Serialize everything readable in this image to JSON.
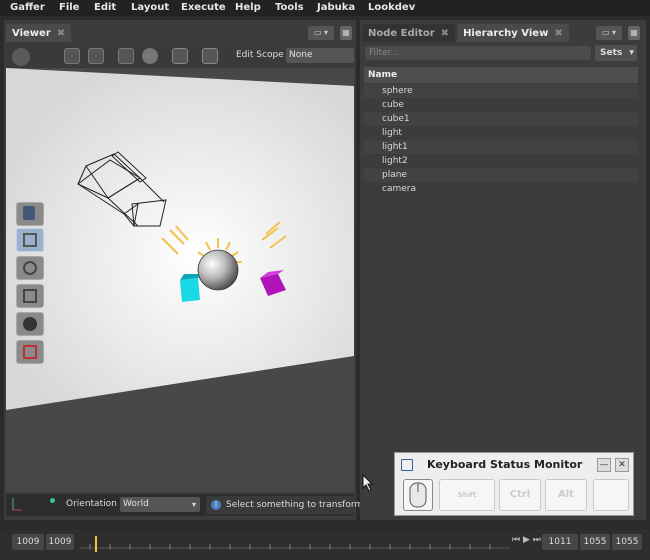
{
  "menubar": [
    "Gaffer",
    "File",
    "Edit",
    "Layout",
    "Execute",
    "Help",
    "Tools",
    "Jabuka",
    "Lookdev"
  ],
  "viewer": {
    "tab_label": "Viewer",
    "edit_scope_label": "Edit Scope",
    "edit_scope_value": "None",
    "orientation_label": "Orientation",
    "orientation_value": "World",
    "status_message": "Select something to transform"
  },
  "right_tabs": [
    {
      "label": "Node Editor",
      "active": false
    },
    {
      "label": "Hierarchy View",
      "active": true
    }
  ],
  "hierarchy": {
    "filter_placeholder": "Filter...",
    "sets_label": "Sets",
    "column_name": "Name",
    "items": [
      "sphere",
      "cube",
      "cube1",
      "light",
      "light1",
      "light2",
      "plane",
      "camera"
    ]
  },
  "monitor": {
    "title": "Keyboard Status Monitor",
    "keys": [
      "Shift",
      "Ctrl",
      "Alt",
      ""
    ]
  },
  "timeline": {
    "start_outer": "1009",
    "start_inner": "1009",
    "end_inner": "1011",
    "end_outer1": "1055",
    "end_outer2": "1055"
  },
  "colors": {
    "accent_blue": "#9bb0cc",
    "light_gizmo": "#f2c24a",
    "cube_cyan": "#19d9e6",
    "cube_magenta": "#b014b8"
  }
}
